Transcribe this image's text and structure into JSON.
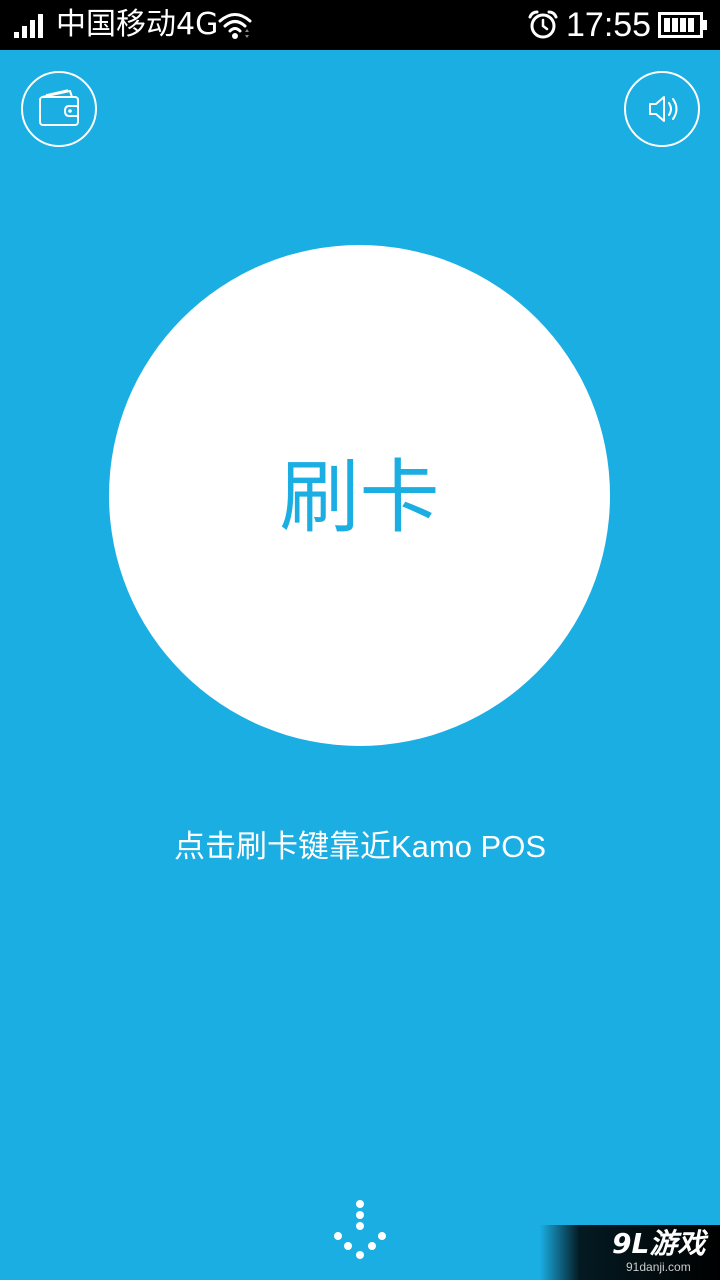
{
  "status_bar": {
    "carrier": "中国移动4G",
    "time": "17:55",
    "icons": [
      "signal-icon",
      "wifi-icon",
      "alarm-icon",
      "battery-icon"
    ]
  },
  "header": {
    "left_button_icon": "wallet-icon",
    "right_button_icon": "speaker-icon"
  },
  "main": {
    "swipe_button_label": "刷卡",
    "hint_text": "点击刷卡键靠近Kamo POS"
  },
  "footer": {
    "indicator_icon": "dots-icon"
  },
  "watermark": {
    "logo": "9L游戏",
    "url": "91danji.com"
  },
  "colors": {
    "background": "#1aaee3",
    "status_bar": "#000000",
    "circle": "#ffffff",
    "accent_text": "#1aaee3"
  }
}
